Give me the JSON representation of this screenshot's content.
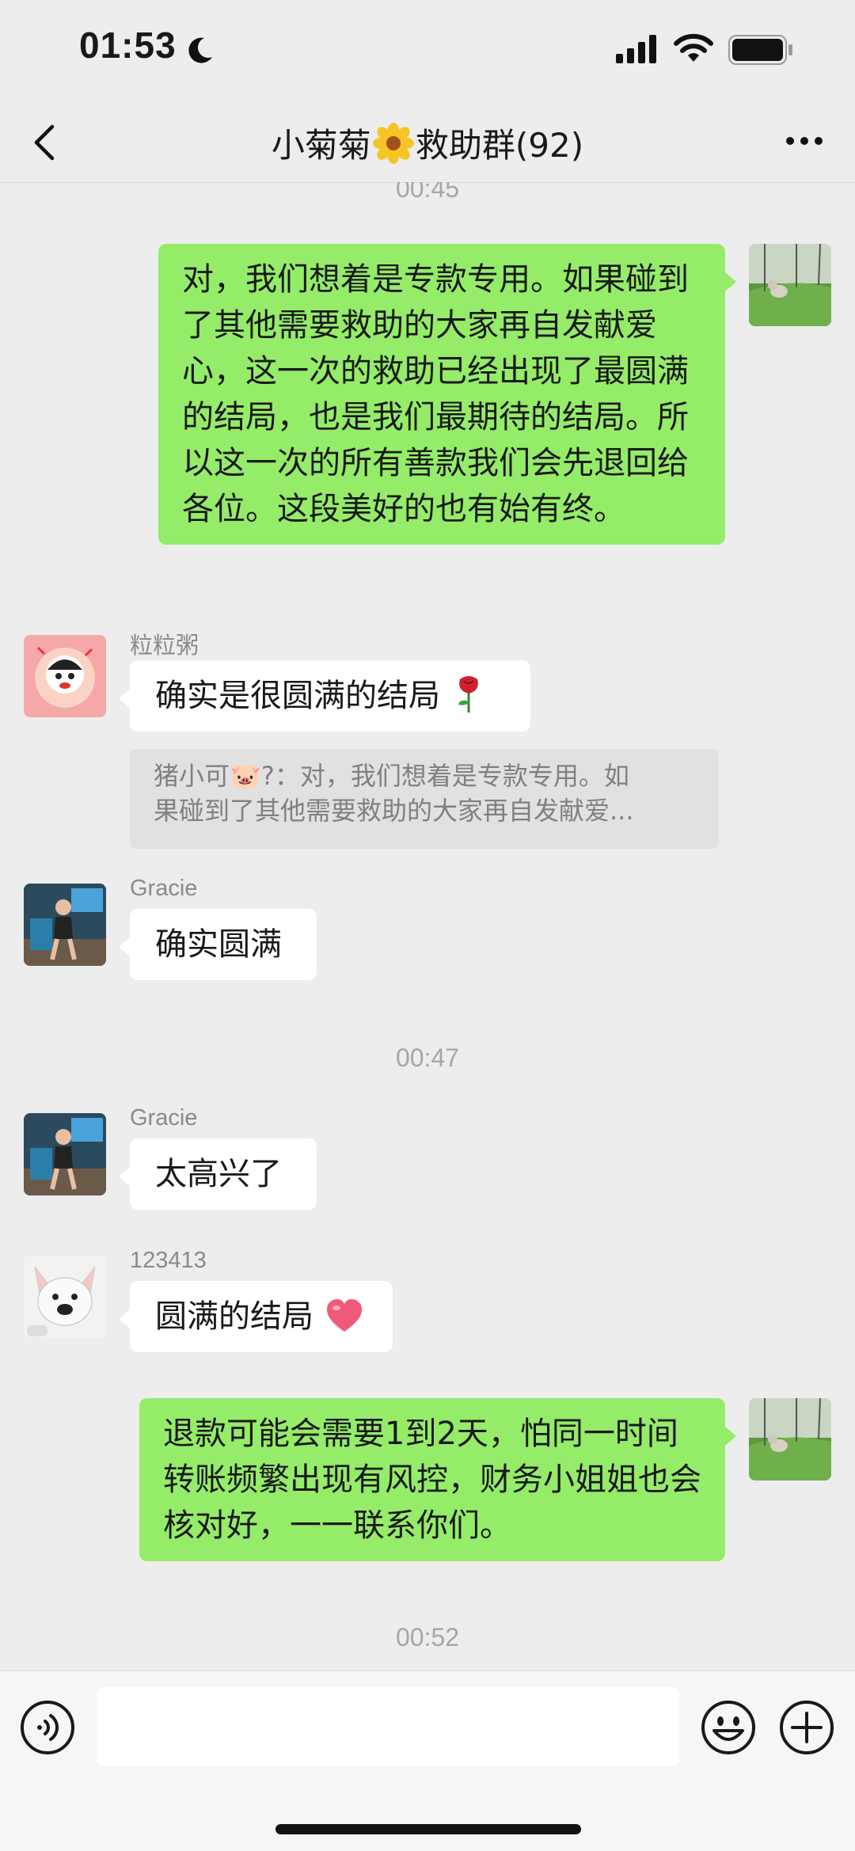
{
  "status_bar": {
    "time": "01:53"
  },
  "header": {
    "title_prefix": "小菊菊",
    "title_suffix": "救助群(92)"
  },
  "messages": {
    "ts_1": "00:45",
    "out_1": "对，我们想着是专款专用。如果碰到了其他需要救助的大家再自发献爱心，这一次的救助已经出现了最圆满的结局，也是我们最期待的结局。所以这一次的所有善款我们会先退回给各位。这段美好的也有始有终。",
    "m2": {
      "sender": "粒粒粥",
      "text": "确实是很圆满的结局",
      "quote_line1": "猪小可🐷?：对，我们想着是专款专用。如",
      "quote_line2": "果碰到了其他需要救助的大家再自发献爱..."
    },
    "m3": {
      "sender": "Gracie",
      "text": "确实圆满"
    },
    "ts_2": "00:47",
    "m4": {
      "sender": "Gracie",
      "text": "太高兴了"
    },
    "m5": {
      "sender": "123413",
      "text": "圆满的结局"
    },
    "out_2": "退款可能会需要1到2天，怕同一时间转账频繁出现有风控，财务小姐姐也会核对好，一一联系你们。",
    "ts_3": "00:52"
  },
  "input": {
    "placeholder": ""
  },
  "colors": {
    "background": "#ededed",
    "outgoing_bubble": "#95ec69",
    "incoming_bubble": "#ffffff",
    "quote_bg": "#e1e1e1",
    "timestamp_text": "#a6a6a6"
  },
  "icons": {
    "status": [
      "moon-icon",
      "signal-icon",
      "wifi-icon",
      "battery-icon"
    ],
    "nav": [
      "back-icon",
      "flower-icon",
      "more-icon"
    ],
    "chat": [
      "rose-icon",
      "heart-icon"
    ],
    "input": [
      "voice-icon",
      "emoji-icon",
      "plus-icon"
    ]
  }
}
